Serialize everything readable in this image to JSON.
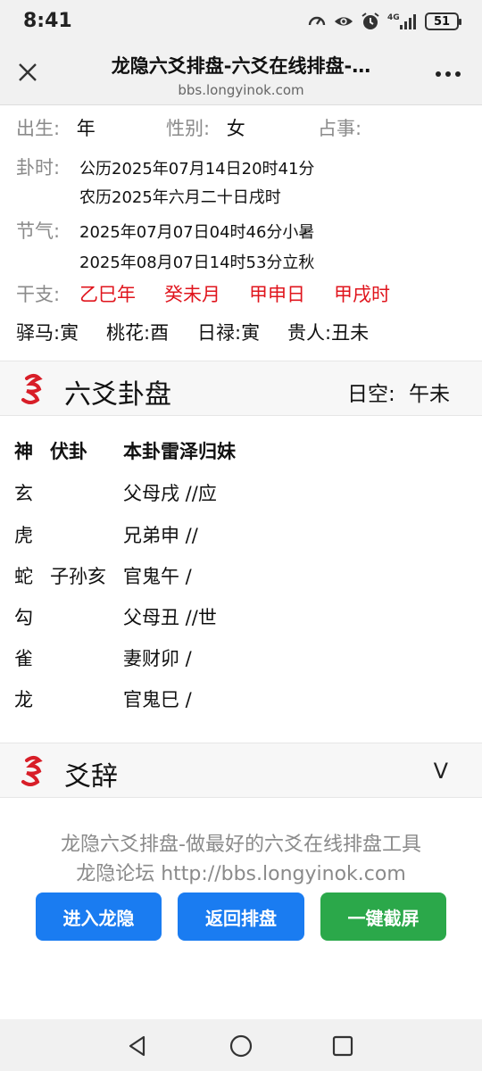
{
  "status_bar": {
    "time": "8:41",
    "signal_label": "4G",
    "battery": "51",
    "icons": [
      "speedometer-icon",
      "eye-icon",
      "alarm-icon",
      "signal-icon",
      "battery-icon"
    ]
  },
  "browser": {
    "title": "龙隐六爻排盘-六爻在线排盘-…",
    "url": "bbs.longyinok.com"
  },
  "info": {
    "birth_label": "出生:",
    "birth_value": "年",
    "gender_label": "性别:",
    "gender_value": "女",
    "matter_label": "占事:",
    "matter_value": "",
    "time_label": "卦时:",
    "time_solar": "公历2025年07月14日20时41分",
    "time_lunar": "农历2025年六月二十日戌时",
    "solar_term_label": "节气:",
    "solar_term_1": "2025年07月07日04时46分小暑",
    "solar_term_2": "2025年08月07日14时53分立秋",
    "ganzhi_label": "干支:",
    "ganzhi": [
      "乙巳年",
      "癸未月",
      "甲申日",
      "甲戌时"
    ],
    "shensha": [
      "驿马:寅",
      "桃花:酉",
      "日禄:寅",
      "贵人:丑未"
    ]
  },
  "hexagram_section": {
    "title": "六爻卦盘",
    "empty_label": "日空:",
    "empty_value": "午未",
    "headers": [
      "神",
      "伏卦",
      "本卦雷泽归妹"
    ],
    "rows": [
      {
        "god": "玄",
        "hidden": "",
        "line": "父母戌 //应"
      },
      {
        "god": "虎",
        "hidden": "",
        "line": "兄弟申 //"
      },
      {
        "god": "蛇",
        "hidden": "子孙亥",
        "line": "官鬼午  /"
      },
      {
        "god": "勾",
        "hidden": "",
        "line": "父母丑 //世"
      },
      {
        "god": "雀",
        "hidden": "",
        "line": "妻财卯  /"
      },
      {
        "god": "龙",
        "hidden": "",
        "line": "官鬼巳  /"
      }
    ]
  },
  "yaoci_section": {
    "title": "爻辞",
    "toggle": "V"
  },
  "footer": {
    "line1": "龙隐六爻排盘-做最好的六爻在线排盘工具",
    "line2": "龙隐论坛 http://bbs.longyinok.com",
    "buttons": [
      "进入龙隐",
      "返回排盘",
      "一键截屏"
    ]
  },
  "colors": {
    "accent_red": "#e0151d",
    "button_blue": "#1a7cf1",
    "button_green": "#2ba84a",
    "label_gray": "#8a8a8a"
  }
}
